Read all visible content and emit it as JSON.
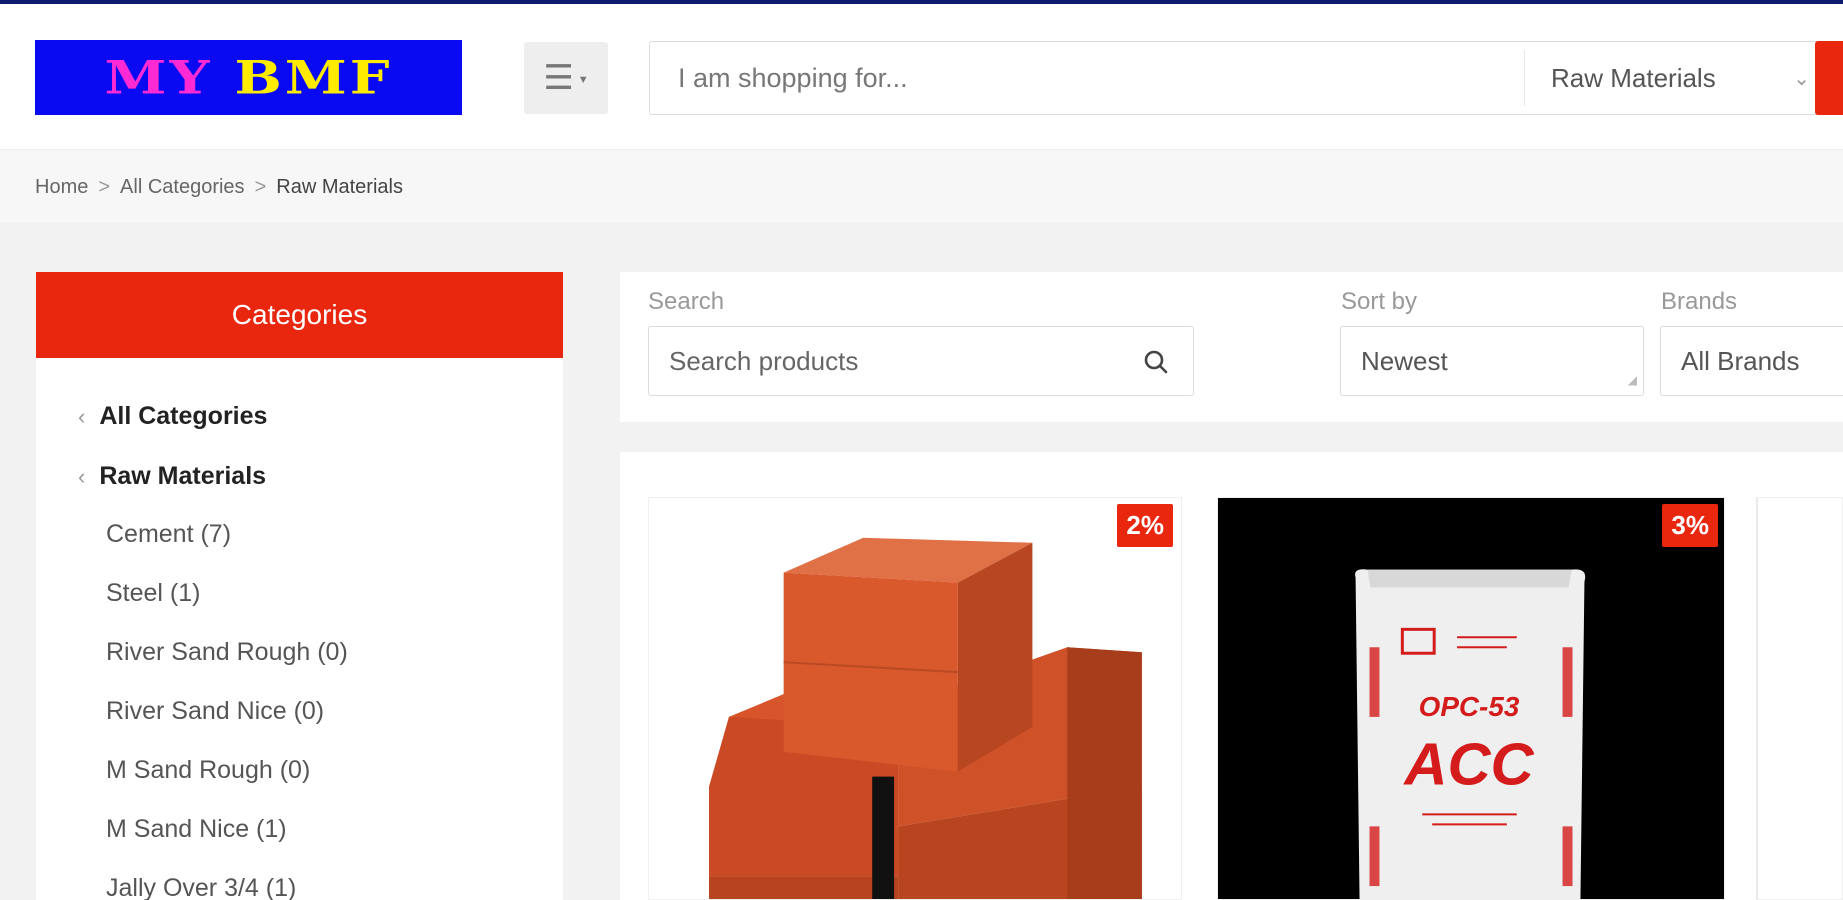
{
  "header": {
    "logo": {
      "word1": "MY",
      "word2": "BMF"
    },
    "search": {
      "placeholder": "I am shopping for...",
      "category": "Raw Materials"
    },
    "colors": {
      "stripe": "#0e1a6b",
      "accent": "#e8270e",
      "logo_bg": "#0a0af2",
      "logo_my": "#ff2ad4",
      "logo_bmf": "#ffeb00"
    }
  },
  "breadcrumb": [
    {
      "label": "Home"
    },
    {
      "label": "All Categories"
    },
    {
      "label": "Raw Materials"
    }
  ],
  "breadcrumb_sep": ">",
  "sidebar": {
    "title": "Categories",
    "items": [
      {
        "label": "All Categories",
        "type": "parent"
      },
      {
        "label": "Raw Materials",
        "type": "parent"
      },
      {
        "label": "Cement (7)",
        "type": "child"
      },
      {
        "label": "Steel (1)",
        "type": "child"
      },
      {
        "label": "River Sand Rough (0)",
        "type": "child"
      },
      {
        "label": "River Sand Nice (0)",
        "type": "child"
      },
      {
        "label": "M Sand Rough (0)",
        "type": "child"
      },
      {
        "label": "M Sand Nice (1)",
        "type": "child"
      },
      {
        "label": "Jally Over 3/4 (1)",
        "type": "child"
      }
    ]
  },
  "filters": {
    "search_label": "Search",
    "search_placeholder": "Search products",
    "sort_label": "Sort by",
    "sort_value": "Newest",
    "brands_label": "Brands",
    "brands_value": "All Brands"
  },
  "products": [
    {
      "discount": "2%",
      "image": "red-bricks"
    },
    {
      "discount": "3%",
      "image": "cement-bag",
      "bag_grade": "OPC-53",
      "bag_brand": "ACC"
    }
  ]
}
